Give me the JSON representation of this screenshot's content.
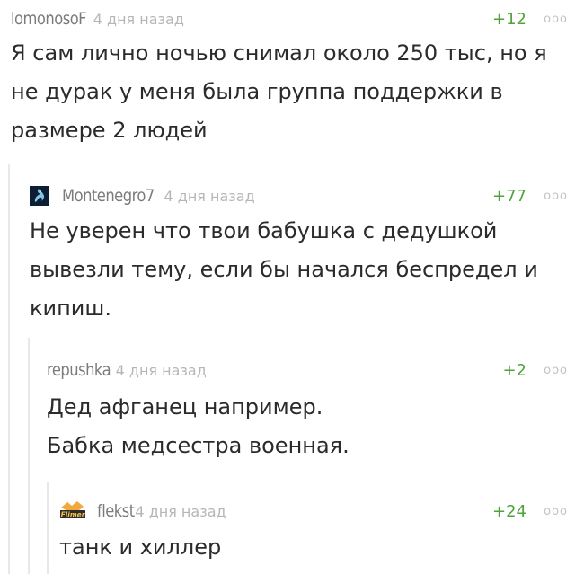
{
  "comments": [
    {
      "author": "lomonosoF",
      "time": "4 дня назад",
      "rating": "+12",
      "more": "ooo",
      "lines": [
        "Я сам лично ночью снимал около 250 тыс, но я",
        "не дурак у меня была группа поддержки в",
        "размере 2 людей"
      ]
    },
    {
      "author": "Montenegro7",
      "time": "4 дня назад",
      "rating": "+77",
      "more": "ooo",
      "lines": [
        "Не уверен что твои бабушка с дедушкой",
        "вывезли тему, если бы начался беспредел и",
        "кипиш."
      ]
    },
    {
      "author": "repushka",
      "time": "4 дня назад",
      "rating": "+2",
      "more": "ooo",
      "lines": [
        "Дед афганец например.",
        "Бабка медсестра военная."
      ]
    },
    {
      "author": "flekst",
      "time": "4 дня назад",
      "rating": "+24",
      "more": "ooo",
      "avatar_text": "Flimer",
      "lines": [
        "танк и хиллер"
      ]
    }
  ],
  "colors": {
    "rating": "#4fa33a",
    "author": "#7b7b7b",
    "time": "#b6b6b6",
    "text": "#2b2b2b",
    "thread_line": "#e8e8e8"
  }
}
